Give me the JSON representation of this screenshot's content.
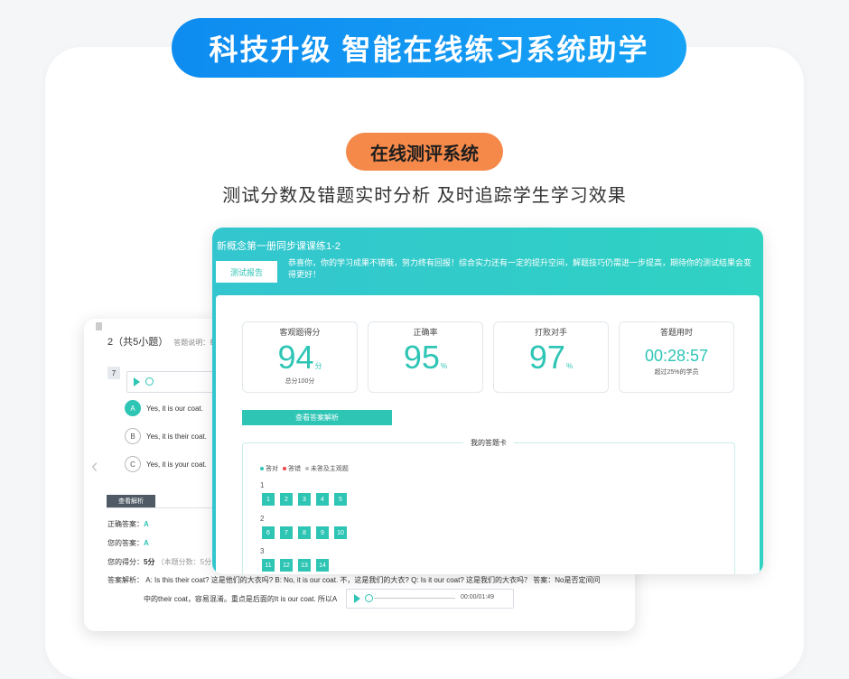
{
  "banner": "科技升级 智能在线练习系统助学",
  "pill": "在线测评系统",
  "subtitle": "测试分数及错题实时分析 及时追踪学生学习效果",
  "back": {
    "question_header": "2（共5小题）",
    "question_note": "答题说明：每题",
    "question_number": "7",
    "options": [
      {
        "letter": "A",
        "text": "Yes, it is our coat."
      },
      {
        "letter": "B",
        "text": "Yes, it is their coat."
      },
      {
        "letter": "C",
        "text": "Yes, it is your coat."
      }
    ],
    "view_analysis": "查看解析",
    "correct_label": "正确答案：",
    "correct_value": "A",
    "your_label": "您的答案：",
    "your_value": "A",
    "score_label": "您的得分：",
    "score_value": "5分",
    "score_note": "（本题分数：5分",
    "explain_label": "答案解析：",
    "explain_line1": "A: Is this their coat? 这是他们的大衣吗? B: No, it is our coat. 不，这是我们的大衣? Q: Is it our coat? 这是我们的大衣吗？ 答案：No是否定间问",
    "explain_line2": "中的their coat，容易混淆。重点是后面的It is our coat. 所以A",
    "audio_time": "00:00/01:49"
  },
  "front": {
    "title": "新概念第一册同步课课练1-2",
    "tab": "测试报告",
    "message": "恭喜你，你的学习成果不错哦，努力终有回报！综合实力还有一定的提升空间，解题技巧仍需进一步提高，期待你的测试结果会变得更好！",
    "stats": [
      {
        "label": "客观题得分",
        "value": "94",
        "unit": "分",
        "sub": "总分100分"
      },
      {
        "label": "正确率",
        "value": "95",
        "unit": "%",
        "sub": ""
      },
      {
        "label": "打败对手",
        "value": "97",
        "unit": "%",
        "sub": ""
      },
      {
        "label": "答题用时",
        "value": "00:28:57",
        "unit": "",
        "sub": "超过25%的学员"
      }
    ],
    "view_analysis": "查看答案解析",
    "answer_card_title": "我的答题卡",
    "legend": {
      "right": "答对",
      "wrong": "答错",
      "unanswered": "未答及主观题"
    },
    "groups": [
      {
        "label": "1",
        "items": [
          "1",
          "2",
          "3",
          "4",
          "5"
        ]
      },
      {
        "label": "2",
        "items": [
          "6",
          "7",
          "8",
          "9",
          "10"
        ]
      },
      {
        "label": "3",
        "items": [
          "11",
          "12",
          "13",
          "14"
        ]
      }
    ]
  }
}
